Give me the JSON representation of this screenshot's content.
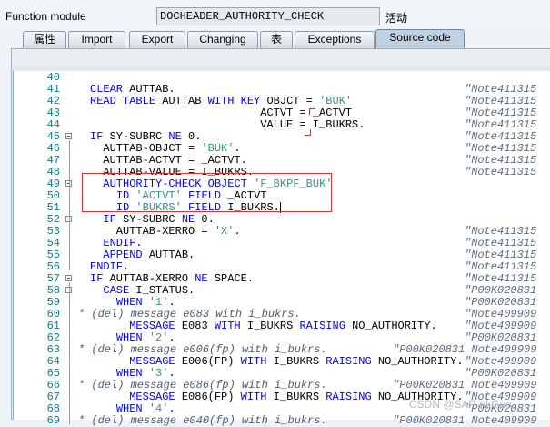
{
  "header": {
    "label": "Function module",
    "value": "DOCHEADER_AUTHORITY_CHECK",
    "status": "活动"
  },
  "tabs": [
    {
      "label": "属性",
      "active": false
    },
    {
      "label": "Import",
      "active": false
    },
    {
      "label": "Export",
      "active": false
    },
    {
      "label": "Changing",
      "active": false
    },
    {
      "label": "表",
      "active": false
    },
    {
      "label": "Exceptions",
      "active": false
    },
    {
      "label": "Source code",
      "active": true
    }
  ],
  "code_lines": [
    {
      "num": "40",
      "code": "",
      "comment": ""
    },
    {
      "num": "41",
      "code": "CLEAR AUTTAB.",
      "comment": "\"Note411315"
    },
    {
      "num": "42",
      "code": "READ TABLE AUTTAB WITH KEY OBJCT = 'BUK'",
      "comment": "\"Note411315"
    },
    {
      "num": "43",
      "code": "                          ACTVT = _ACTVT",
      "comment": "\"Note411315"
    },
    {
      "num": "44",
      "code": "                          VALUE = I_BUKRS.",
      "comment": "\"Note411315"
    },
    {
      "num": "45",
      "code": "IF SY-SUBRC NE 0.",
      "comment": "\"Note411315"
    },
    {
      "num": "46",
      "code": "  AUTTAB-OBJCT = 'BUK'.",
      "comment": "\"Note411315"
    },
    {
      "num": "47",
      "code": "  AUTTAB-ACTVT = _ACTVT.",
      "comment": "\"Note411315"
    },
    {
      "num": "48",
      "code": "  AUTTAB-VALUE = I_BUKRS.",
      "comment": "\"Note411315"
    },
    {
      "num": "49",
      "code": "  AUTHORITY-CHECK OBJECT 'F_BKPF_BUK'",
      "comment": ""
    },
    {
      "num": "50",
      "code": "    ID 'ACTVT' FIELD _ACTVT",
      "comment": ""
    },
    {
      "num": "51",
      "code": "    ID 'BUKRS' FIELD I_BUKRS.",
      "comment": ""
    },
    {
      "num": "52",
      "code": "  IF SY-SUBRC NE 0.",
      "comment": ""
    },
    {
      "num": "53",
      "code": "    AUTTAB-XERRO = 'X'.",
      "comment": "\"Note411315"
    },
    {
      "num": "54",
      "code": "  ENDIF.",
      "comment": "\"Note411315"
    },
    {
      "num": "55",
      "code": "  APPEND AUTTAB.",
      "comment": "\"Note411315"
    },
    {
      "num": "56",
      "code": "ENDIF.",
      "comment": "\"Note411315"
    },
    {
      "num": "57",
      "code": "IF AUTTAB-XERRO NE SPACE.",
      "comment": "\"Note411315"
    },
    {
      "num": "58",
      "code": "  CASE I_STATUS.",
      "comment": "\"P00K020831"
    },
    {
      "num": "59",
      "code": "    WHEN '1'.",
      "comment": "\"P00K020831"
    },
    {
      "num": "60",
      "code": "* (del) message e083 with i_bukrs.",
      "comment": "\"Note409909"
    },
    {
      "num": "61",
      "code": "      MESSAGE E083 WITH I_BUKRS RAISING NO_AUTHORITY.",
      "comment": "\"Note409909"
    },
    {
      "num": "62",
      "code": "    WHEN '2'.",
      "comment": "\"P00K020831"
    },
    {
      "num": "63",
      "code": "* (del) message e006(fp) with i_bukrs.",
      "comment": "\"P00K020831 Note409909"
    },
    {
      "num": "64",
      "code": "      MESSAGE E006(FP) WITH I_BUKRS RAISING NO_AUTHORITY.",
      "comment": "\"Note409909"
    },
    {
      "num": "65",
      "code": "    WHEN '3'.",
      "comment": "\"P00K020831"
    },
    {
      "num": "66",
      "code": "* (del) message e086(fp) with i_bukrs.",
      "comment": "\"P00K020831 Note409909"
    },
    {
      "num": "67",
      "code": "      MESSAGE E086(FP) WITH I_BUKRS RAISING NO_AUTHORITY.",
      "comment": "\"Note409909"
    },
    {
      "num": "68",
      "code": "    WHEN '4'.",
      "comment": "\"P00K020831"
    },
    {
      "num": "69",
      "code": "* (del) message e040(fp) with i_bukrs.",
      "comment": "\"P00K020831 Note409909"
    }
  ],
  "watermark": "CSDN @SAP-nkGuo",
  "icons": {
    "fold": "collapse-box-icon"
  },
  "colors": {
    "keyword": "#0000ff",
    "string": "#3c8f8a",
    "line_number": "#0a7e8c",
    "highlight": "#e03030"
  }
}
